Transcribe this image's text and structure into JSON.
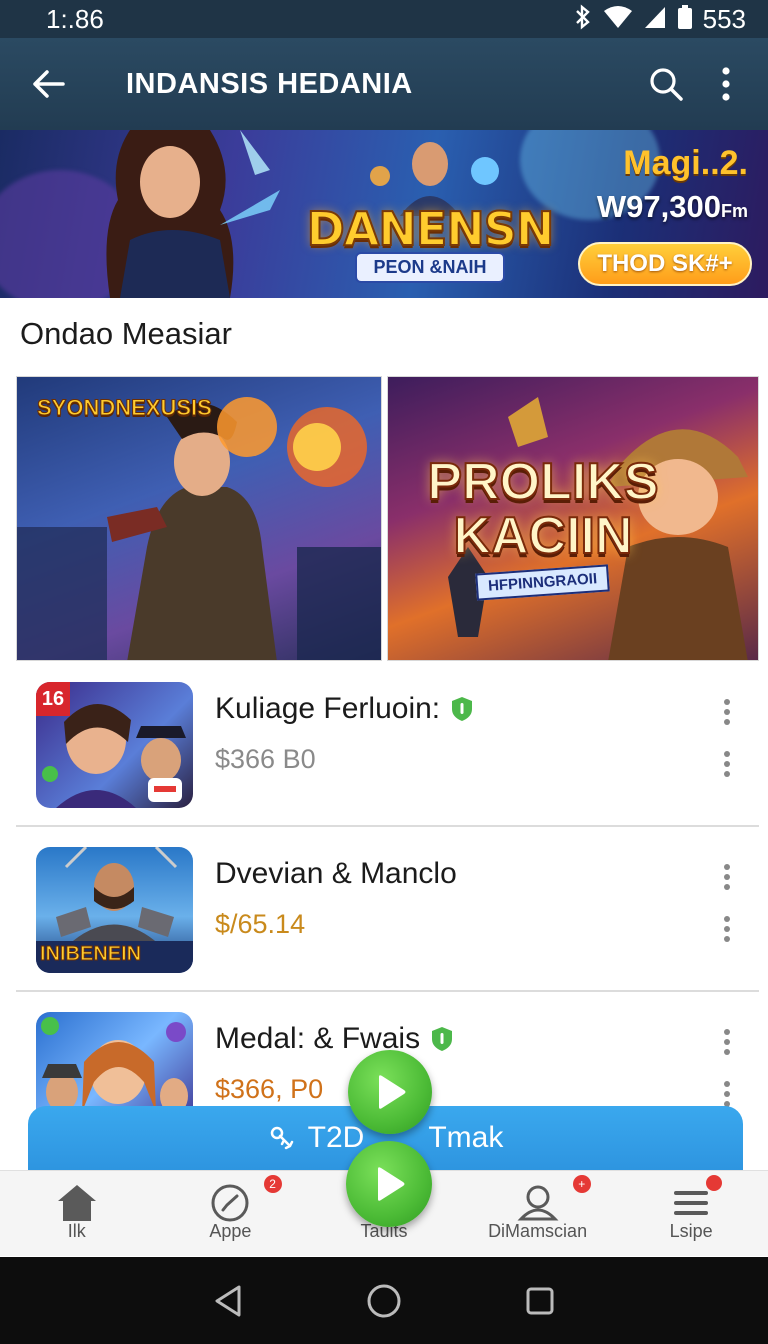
{
  "status_bar": {
    "time": "1:.86",
    "battery": "553"
  },
  "app_bar": {
    "title": "INDANSIS HEDANIA"
  },
  "banner": {
    "logo_text": "DANENSN",
    "logo_sub": "PEON &NAIH",
    "promo_title": "Magi..2.",
    "promo_amount": "W97,300",
    "promo_unit": "Fm",
    "button_label": "THOD SK#+"
  },
  "section": {
    "title": "Ondao Measiar"
  },
  "featured": [
    {
      "tag": "SYONDNEXUSIS"
    },
    {
      "title_line1": "PROLIKS",
      "title_line2": "KACIIN",
      "subtitle": "HFPINNGRAOII"
    }
  ],
  "list": [
    {
      "name": "Kuliage Ferluoin:",
      "price": "$366 B0",
      "price_color": "#8a8a8a",
      "verified": true,
      "badge": "16"
    },
    {
      "name": "Dvevian & Manclo",
      "price": "$/65.14",
      "price_color": "#c98a1c",
      "verified": false,
      "icon_caption": "INIBENEIN"
    },
    {
      "name": "Medal: & Fwais",
      "price": "$366, P0",
      "price_color": "#d0721a",
      "verified": true
    }
  ],
  "cta": {
    "label": "T2D",
    "label_tail": "Tmak"
  },
  "bottom_nav": [
    {
      "label": "Ilk",
      "icon": "home-icon"
    },
    {
      "label": "Appe",
      "icon": "compass-icon",
      "badge": "2"
    },
    {
      "label": "Tauits",
      "icon": "play-icon"
    },
    {
      "label": "DiMamscian",
      "icon": "profile-icon",
      "badge": "+"
    },
    {
      "label": "Lsipe",
      "icon": "menu-icon",
      "badge_dot": true
    }
  ],
  "colors": {
    "app_bar": "#223c52",
    "accent_green": "#4cbb36",
    "cta_blue": "#2e95e0",
    "badge_red": "#e53935"
  }
}
